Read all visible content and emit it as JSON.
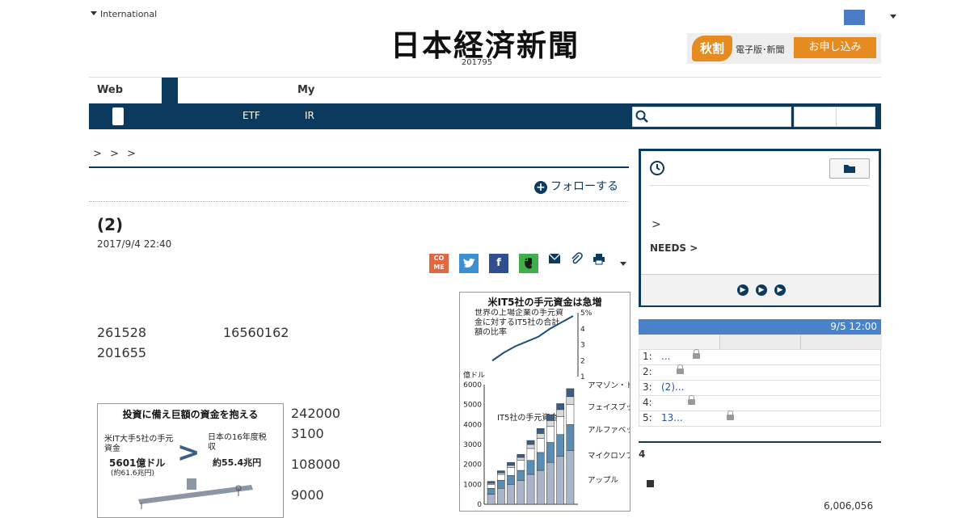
{
  "header": {
    "edition": "International",
    "logo": "日本経済新聞",
    "date_label": "201795",
    "promo": {
      "badge": "秋割",
      "text": "電子版･新聞",
      "button": "お申し込み"
    }
  },
  "nav": {
    "tabs": [
      "Web",
      "My"
    ],
    "links": [
      "ETF",
      "IR"
    ]
  },
  "breadcrumb": "> > >",
  "article": {
    "follow": "フォローする",
    "title": "(2)",
    "date": "2017/9/4 22:40",
    "share": {
      "come": "CO ME"
    },
    "lines": [
      "261528",
      "16560162",
      "201655",
      "242000",
      "3100",
      "108000",
      "9000"
    ]
  },
  "chart_data": {
    "type": "bar",
    "title": "米IT5社の手元資金は急増",
    "note": "世界の上場企業の手元資金に対するIT5社の合計額の比率",
    "ylabel": "億ドル",
    "ylim": [
      0,
      6000
    ],
    "y_ticks": [
      "6000",
      "5000",
      "4000",
      "3000",
      "2000",
      "1000",
      "0"
    ],
    "ratio_ticks": [
      "5%",
      "4",
      "3",
      "2",
      "1"
    ],
    "ratio_ylim": [
      1,
      5
    ],
    "ratio_line": [
      2.0,
      2.5,
      2.9,
      3.2,
      3.5,
      4.0,
      4.4,
      4.8
    ],
    "series_label": "IT5社の手元資金",
    "stack_colors": [
      "#aab4c8",
      "#5b8db3",
      "#ffffff",
      "#d9d9d9",
      "#3a5f86"
    ],
    "series": [
      {
        "name": "アップル",
        "values": [
          500,
          800,
          1000,
          1200,
          1500,
          1700,
          2100,
          2400,
          2700
        ]
      },
      {
        "name": "マイクロソフト",
        "values": [
          300,
          400,
          450,
          500,
          700,
          900,
          1000,
          1100,
          1300
        ]
      },
      {
        "name": "アルファベット",
        "values": [
          200,
          300,
          400,
          500,
          600,
          700,
          800,
          900,
          1000
        ]
      },
      {
        "name": "フェイスブック",
        "values": [
          50,
          80,
          100,
          150,
          200,
          250,
          300,
          350,
          400
        ]
      },
      {
        "name": "アマゾン・ドット・コム",
        "values": [
          100,
          100,
          150,
          150,
          200,
          250,
          300,
          300,
          400
        ]
      }
    ]
  },
  "infographic": {
    "title": "投資に備え巨額の資金を抱える",
    "left_label": "米IT大手5社の手元資金",
    "left_value": "5601億ドル",
    "left_note": "(約61.6兆円)",
    "right_label": "日本の16年度税収",
    "right_value": "約55.4兆円"
  },
  "sidebar": {
    "needs": "NEEDS",
    "ranking_time": "9/5 12:00",
    "ranking": [
      {
        "n": "1:",
        "t": "...",
        "locked": true
      },
      {
        "n": "2:",
        "t": "",
        "locked": true
      },
      {
        "n": "3:",
        "t": "(2)...",
        "locked": false
      },
      {
        "n": "4:",
        "t": "",
        "locked": true
      },
      {
        "n": "5:",
        "t": "13...",
        "locked": true
      }
    ],
    "section4": "4",
    "bignum": "6,006,056"
  }
}
